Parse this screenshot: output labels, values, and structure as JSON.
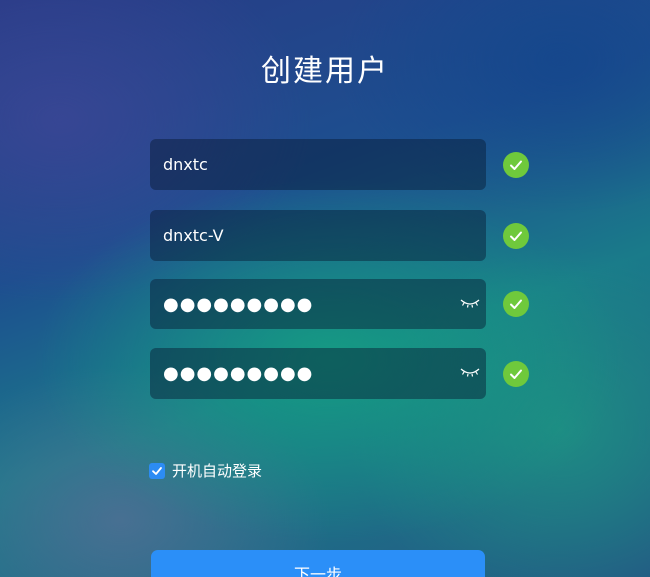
{
  "page": {
    "title": "创建用户"
  },
  "form": {
    "username": {
      "value": "dnxtc"
    },
    "fullname": {
      "value": "dnxtc-V"
    },
    "password": {
      "value": "●●●●●●●●●"
    },
    "password_confirm": {
      "value": "●●●●●●●●●"
    }
  },
  "icons": {
    "valid": "check-circle-icon",
    "eye": "eye-closed-icon",
    "checkbox": "checkbox-checked-icon"
  },
  "colors": {
    "valid_check": "#6fc93c",
    "primary_button": "#2b8ff8",
    "checkbox": "#2c8cf4"
  },
  "options": {
    "autologin": {
      "label": "开机自动登录",
      "checked": true
    }
  },
  "actions": {
    "next_label": "下一步"
  }
}
